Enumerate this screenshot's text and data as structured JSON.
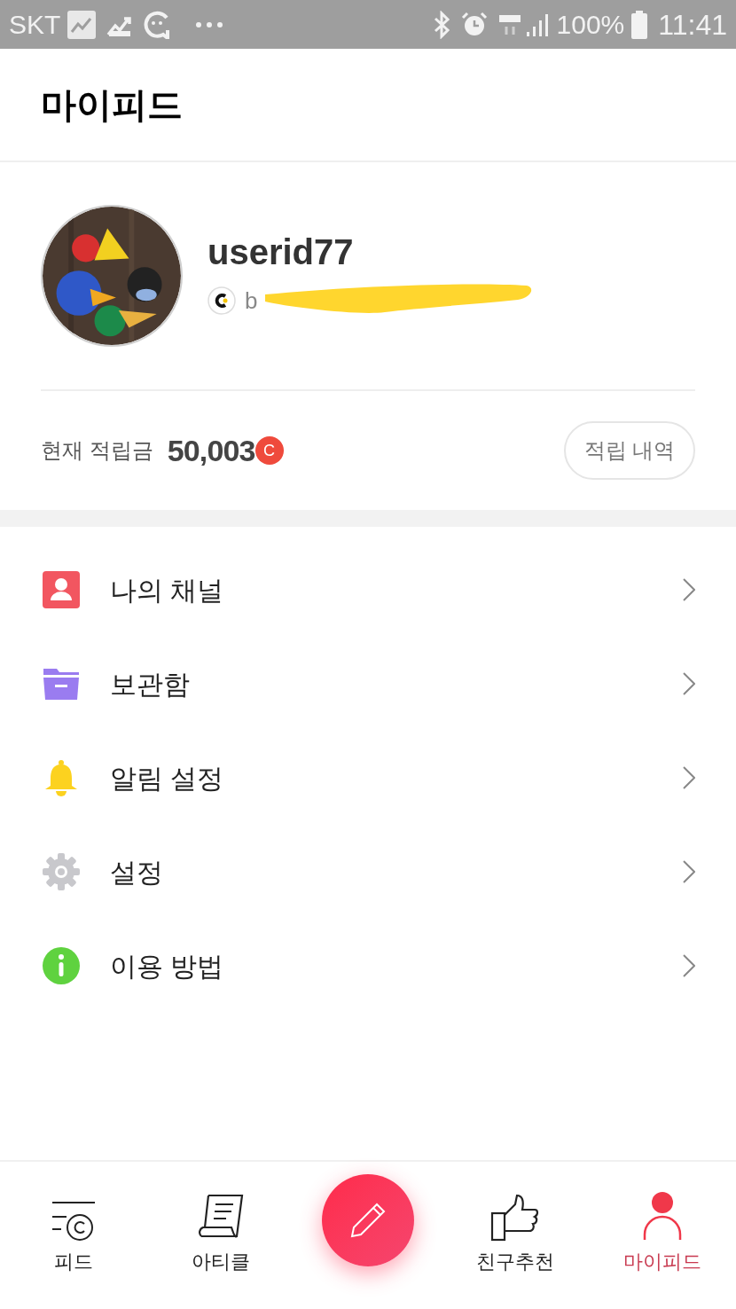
{
  "status_bar": {
    "carrier": "SKT",
    "battery": "100%",
    "time": "11:41"
  },
  "header": {
    "title": "마이피드"
  },
  "profile": {
    "username": "userid77",
    "email": "b"
  },
  "points": {
    "label": "현재 적립금",
    "amount": "50,003",
    "coin": "C",
    "button": "적립 내역"
  },
  "menu": [
    {
      "kind": "channel",
      "label": "나의 채널"
    },
    {
      "kind": "storage",
      "label": "보관함"
    },
    {
      "kind": "alarm",
      "label": "알림 설정"
    },
    {
      "kind": "settings",
      "label": "설정"
    },
    {
      "kind": "help",
      "label": "이용 방법"
    }
  ],
  "bottom_nav": [
    {
      "kind": "feed",
      "label": "피드",
      "selected": false
    },
    {
      "kind": "article",
      "label": "아티클",
      "selected": false
    },
    {
      "kind": "write"
    },
    {
      "kind": "recommend",
      "label": "친구추천",
      "selected": false
    },
    {
      "kind": "mypage",
      "label": "마이피드",
      "selected": true
    }
  ]
}
